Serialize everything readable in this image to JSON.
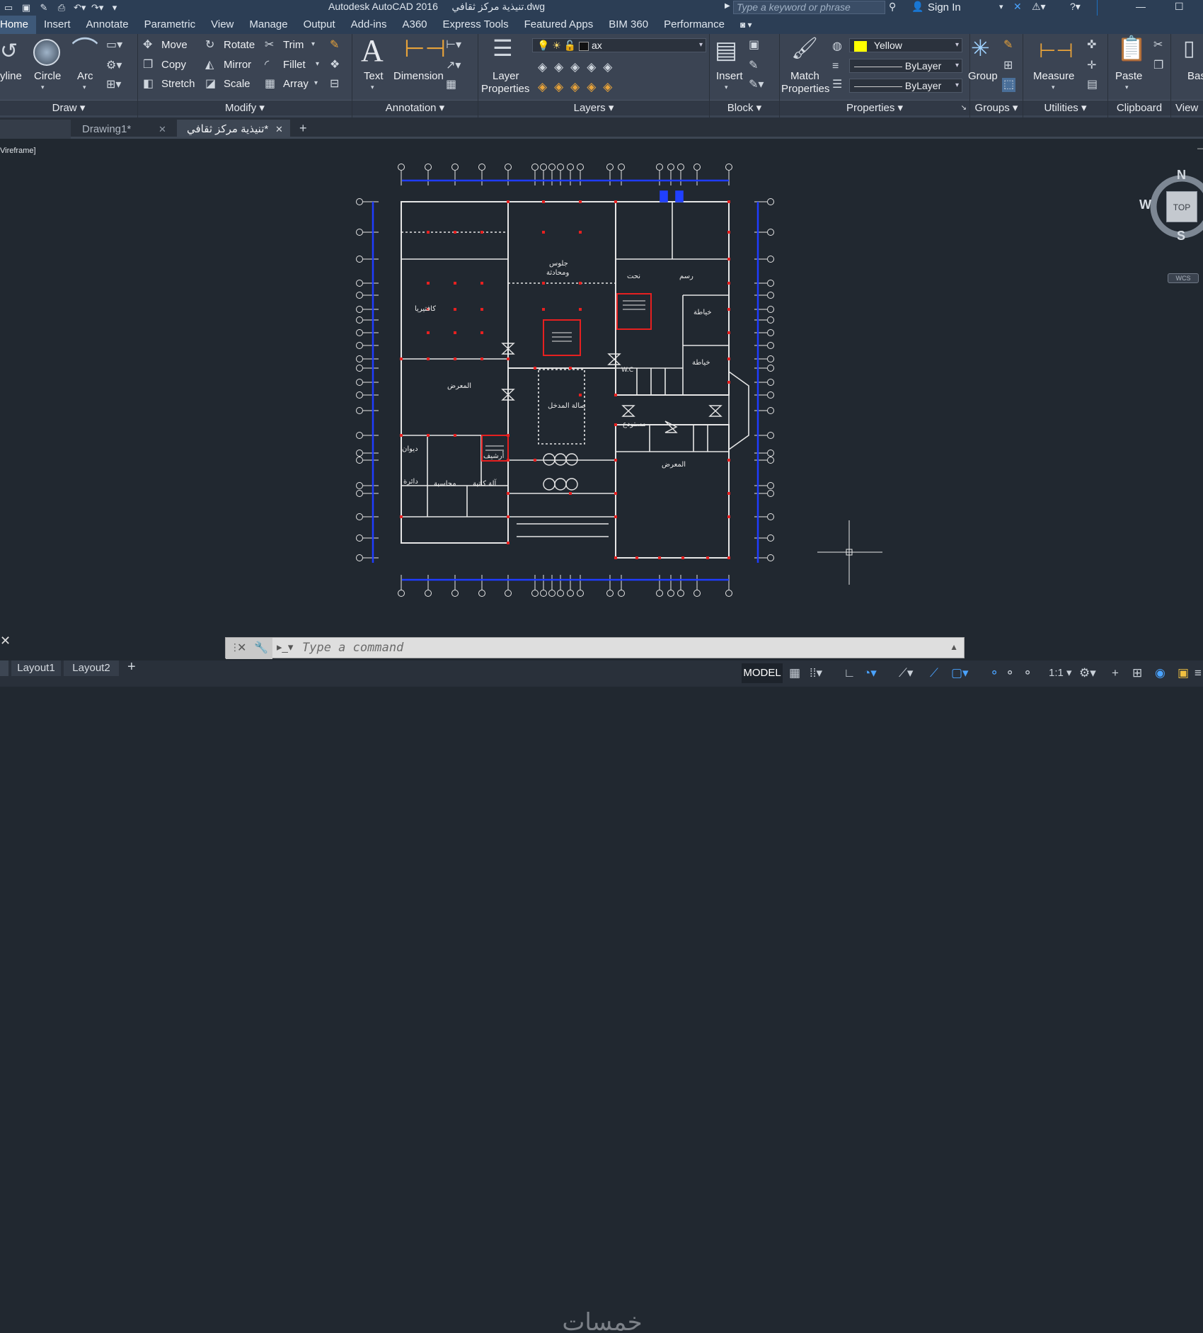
{
  "window": {
    "title": "Autodesk AutoCAD 2016",
    "file": "تنيذية مركز ثقافي.dwg"
  },
  "search": {
    "placeholder": "Type a keyword or phrase"
  },
  "account": {
    "sign_in": "Sign In"
  },
  "menu_tabs": [
    "Home",
    "Insert",
    "Annotate",
    "Parametric",
    "View",
    "Manage",
    "Output",
    "Add-ins",
    "A360",
    "Express Tools",
    "Featured Apps",
    "BIM 360",
    "Performance"
  ],
  "ribbon": {
    "draw": {
      "polyline": "yline",
      "circle": "Circle",
      "arc": "Arc",
      "panel": "Draw"
    },
    "modify": {
      "move": "Move",
      "rotate": "Rotate",
      "trim": "Trim",
      "copy": "Copy",
      "mirror": "Mirror",
      "fillet": "Fillet",
      "stretch": "Stretch",
      "scale": "Scale",
      "array": "Array",
      "panel": "Modify"
    },
    "annotation": {
      "text": "Text",
      "dimension": "Dimension",
      "panel": "Annotation"
    },
    "layers": {
      "layer_properties_1": "Layer",
      "layer_properties_2": "Properties",
      "current_layer": "ax",
      "panel": "Layers"
    },
    "block": {
      "insert": "Insert",
      "panel": "Block"
    },
    "properties": {
      "match_1": "Match",
      "match_2": "Properties",
      "color": "Yellow",
      "linetype": "ByLayer",
      "lineweight": "ByLayer",
      "panel": "Properties"
    },
    "groups": {
      "group": "Group",
      "panel": "Groups"
    },
    "utilities": {
      "measure": "Measure",
      "panel": "Utilities"
    },
    "clipboard": {
      "paste": "Paste",
      "panel": "Clipboard"
    },
    "view": {
      "base": "Bas",
      "panel": "View"
    }
  },
  "doc_tabs": [
    "Drawing1*",
    "تنيذية مركز ثقافي*"
  ],
  "viewport": {
    "label": "Vireframe]"
  },
  "viewcube": {
    "n": "N",
    "w": "W",
    "s": "S",
    "top": "TOP",
    "wcs": "WCS"
  },
  "plan_labels": {
    "lounge_1": "جلوس",
    "lounge_2": "ومحادثة",
    "cafeteria": "كافتيريا",
    "gallery_a": "المعرض",
    "entrance_hall": "صالة المدخل",
    "sculpture": "نحت",
    "drawing": "رسم",
    "calligraphy_a": "خياطة",
    "calligraphy_b": "خياطة",
    "storage": "مستودع",
    "gallery_b": "المعرض",
    "reception": "ديوان",
    "archive": "أرشيف",
    "accounting": "محاسبة",
    "library": "آلة كاتبة",
    "manager": "دائرة",
    "wc": "W.C"
  },
  "command": {
    "placeholder": "Type a command"
  },
  "layouts": [
    "Layout1",
    "Layout2"
  ],
  "status": {
    "model": "MODEL",
    "scale": "1:1"
  },
  "watermark": "خمسات"
}
